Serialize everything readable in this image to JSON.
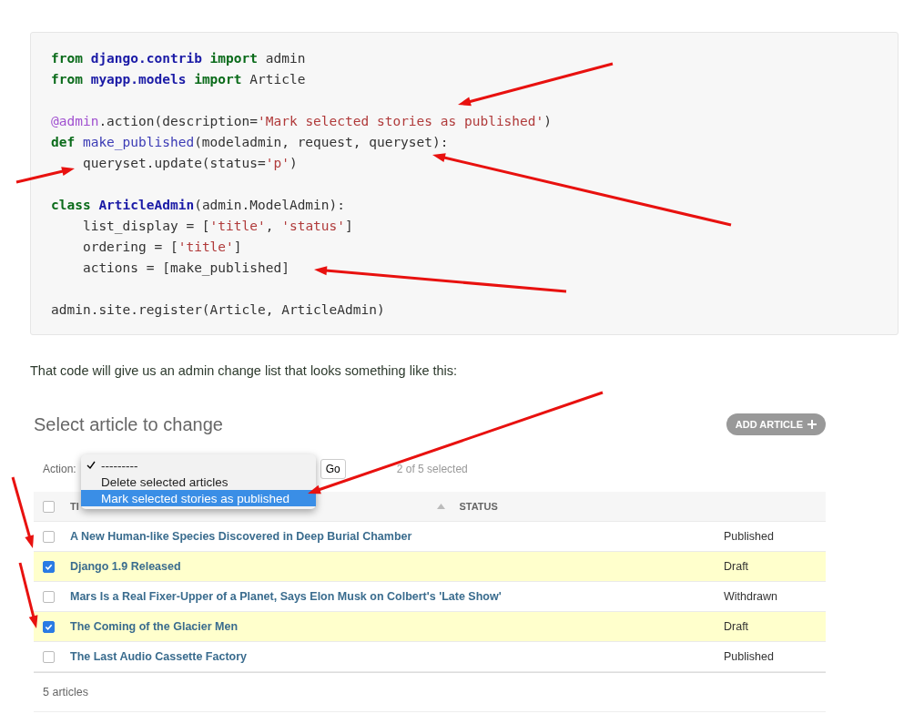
{
  "code_blocks": [
    [
      [
        {
          "kind": "kw",
          "text": "from "
        },
        {
          "kind": "ns",
          "text": "django.contrib "
        },
        {
          "kind": "kw",
          "text": "import"
        },
        {
          "kind": "plain",
          "text": " admin"
        }
      ],
      [
        {
          "kind": "kw",
          "text": "from "
        },
        {
          "kind": "ns",
          "text": "myapp.models "
        },
        {
          "kind": "kw",
          "text": "import"
        },
        {
          "kind": "plain",
          "text": " Article"
        }
      ]
    ],
    [
      [
        {
          "kind": "dec",
          "text": "@admin"
        },
        {
          "kind": "plain",
          "text": ".action(description="
        },
        {
          "kind": "str",
          "text": "'Mark selected stories as published'"
        },
        {
          "kind": "plain",
          "text": ")"
        }
      ],
      [
        {
          "kind": "kw",
          "text": "def "
        },
        {
          "kind": "fn",
          "text": "make_published"
        },
        {
          "kind": "plain",
          "text": "(modeladmin, request, queryset):"
        }
      ],
      [
        {
          "kind": "plain",
          "text": "    queryset.update(status="
        },
        {
          "kind": "str",
          "text": "'p'"
        },
        {
          "kind": "plain",
          "text": ")"
        }
      ]
    ],
    [
      [
        {
          "kind": "kw",
          "text": "class "
        },
        {
          "kind": "cls",
          "text": "ArticleAdmin"
        },
        {
          "kind": "plain",
          "text": "(admin.ModelAdmin):"
        }
      ],
      [
        {
          "kind": "plain",
          "text": "    list_display = ["
        },
        {
          "kind": "str",
          "text": "'title'"
        },
        {
          "kind": "plain",
          "text": ", "
        },
        {
          "kind": "str",
          "text": "'status'"
        },
        {
          "kind": "plain",
          "text": "]"
        }
      ],
      [
        {
          "kind": "plain",
          "text": "    ordering = ["
        },
        {
          "kind": "str",
          "text": "'title'"
        },
        {
          "kind": "plain",
          "text": "]"
        }
      ],
      [
        {
          "kind": "plain",
          "text": "    actions = [make_published]"
        }
      ]
    ],
    [
      [
        {
          "kind": "plain",
          "text": "admin.site.register(Article, ArticleAdmin)"
        }
      ]
    ]
  ],
  "body_text": "That code will give us an admin change list that looks something like this:",
  "admin": {
    "title": "Select article to change",
    "add_button": "ADD ARTICLE",
    "action_label": "Action:",
    "go_button": "Go",
    "selection_count": "2 of 5 selected",
    "action_options": [
      {
        "label": "---------",
        "checked": true,
        "selected": false
      },
      {
        "label": "Delete selected articles",
        "checked": false,
        "selected": false
      },
      {
        "label": "Mark selected stories as published",
        "checked": false,
        "selected": true
      }
    ],
    "header_select_all": {
      "checked": false
    },
    "columns": [
      "TI",
      "STATUS"
    ],
    "rows": [
      {
        "checked": false,
        "title": "A New Human-like Species Discovered in Deep Burial Chamber",
        "status": "Published"
      },
      {
        "checked": true,
        "title": "Django 1.9 Released",
        "status": "Draft"
      },
      {
        "checked": false,
        "title": "Mars Is a Real Fixer-Upper of a Planet, Says Elon Musk on Colbert's 'Late Show'",
        "status": "Withdrawn"
      },
      {
        "checked": true,
        "title": "The Coming of the Glacier Men",
        "status": "Draft"
      },
      {
        "checked": false,
        "title": "The Last Audio Cassette Factory",
        "status": "Published"
      }
    ],
    "footer": "5 articles"
  }
}
